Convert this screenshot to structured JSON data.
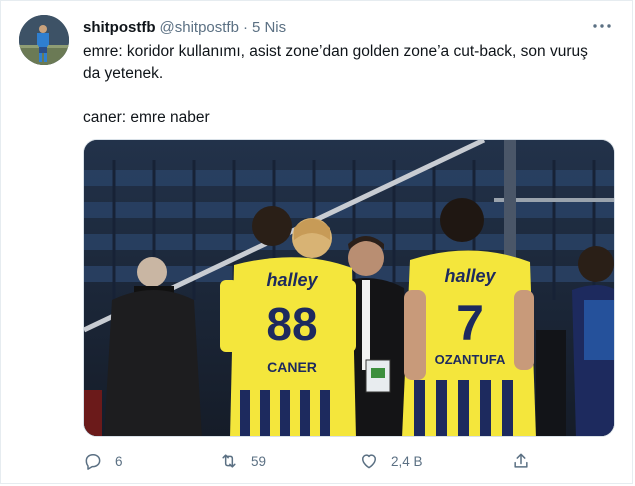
{
  "tweet": {
    "display_name": "shitpostfb",
    "handle": "@shitpostfb",
    "separator": "·",
    "date": "5 Nis",
    "text_line1": "emre: koridor kullanımı, asist zone’dan golden zone’a cut-back, son vuruş da yetenek.",
    "text_line2": "caner: emre naber"
  },
  "media": {
    "jersey_brand_1": "halley",
    "jersey_number_1": "88",
    "jersey_name_1": "CANER",
    "jersey_brand_2": "halley",
    "jersey_number_2": "7",
    "jersey_name_2": "OZANTUFA"
  },
  "actions": {
    "reply_count": "6",
    "retweet_count": "59",
    "like_count": "2,4 B",
    "reply_icon": "reply-icon",
    "retweet_icon": "retweet-icon",
    "like_icon": "heart-icon",
    "share_icon": "share-icon"
  },
  "colors": {
    "accent_text": "#5b7083",
    "jersey_yellow": "#f4e63c",
    "jersey_navy": "#1d2a5e",
    "stadium_blue": "#1b2433"
  }
}
